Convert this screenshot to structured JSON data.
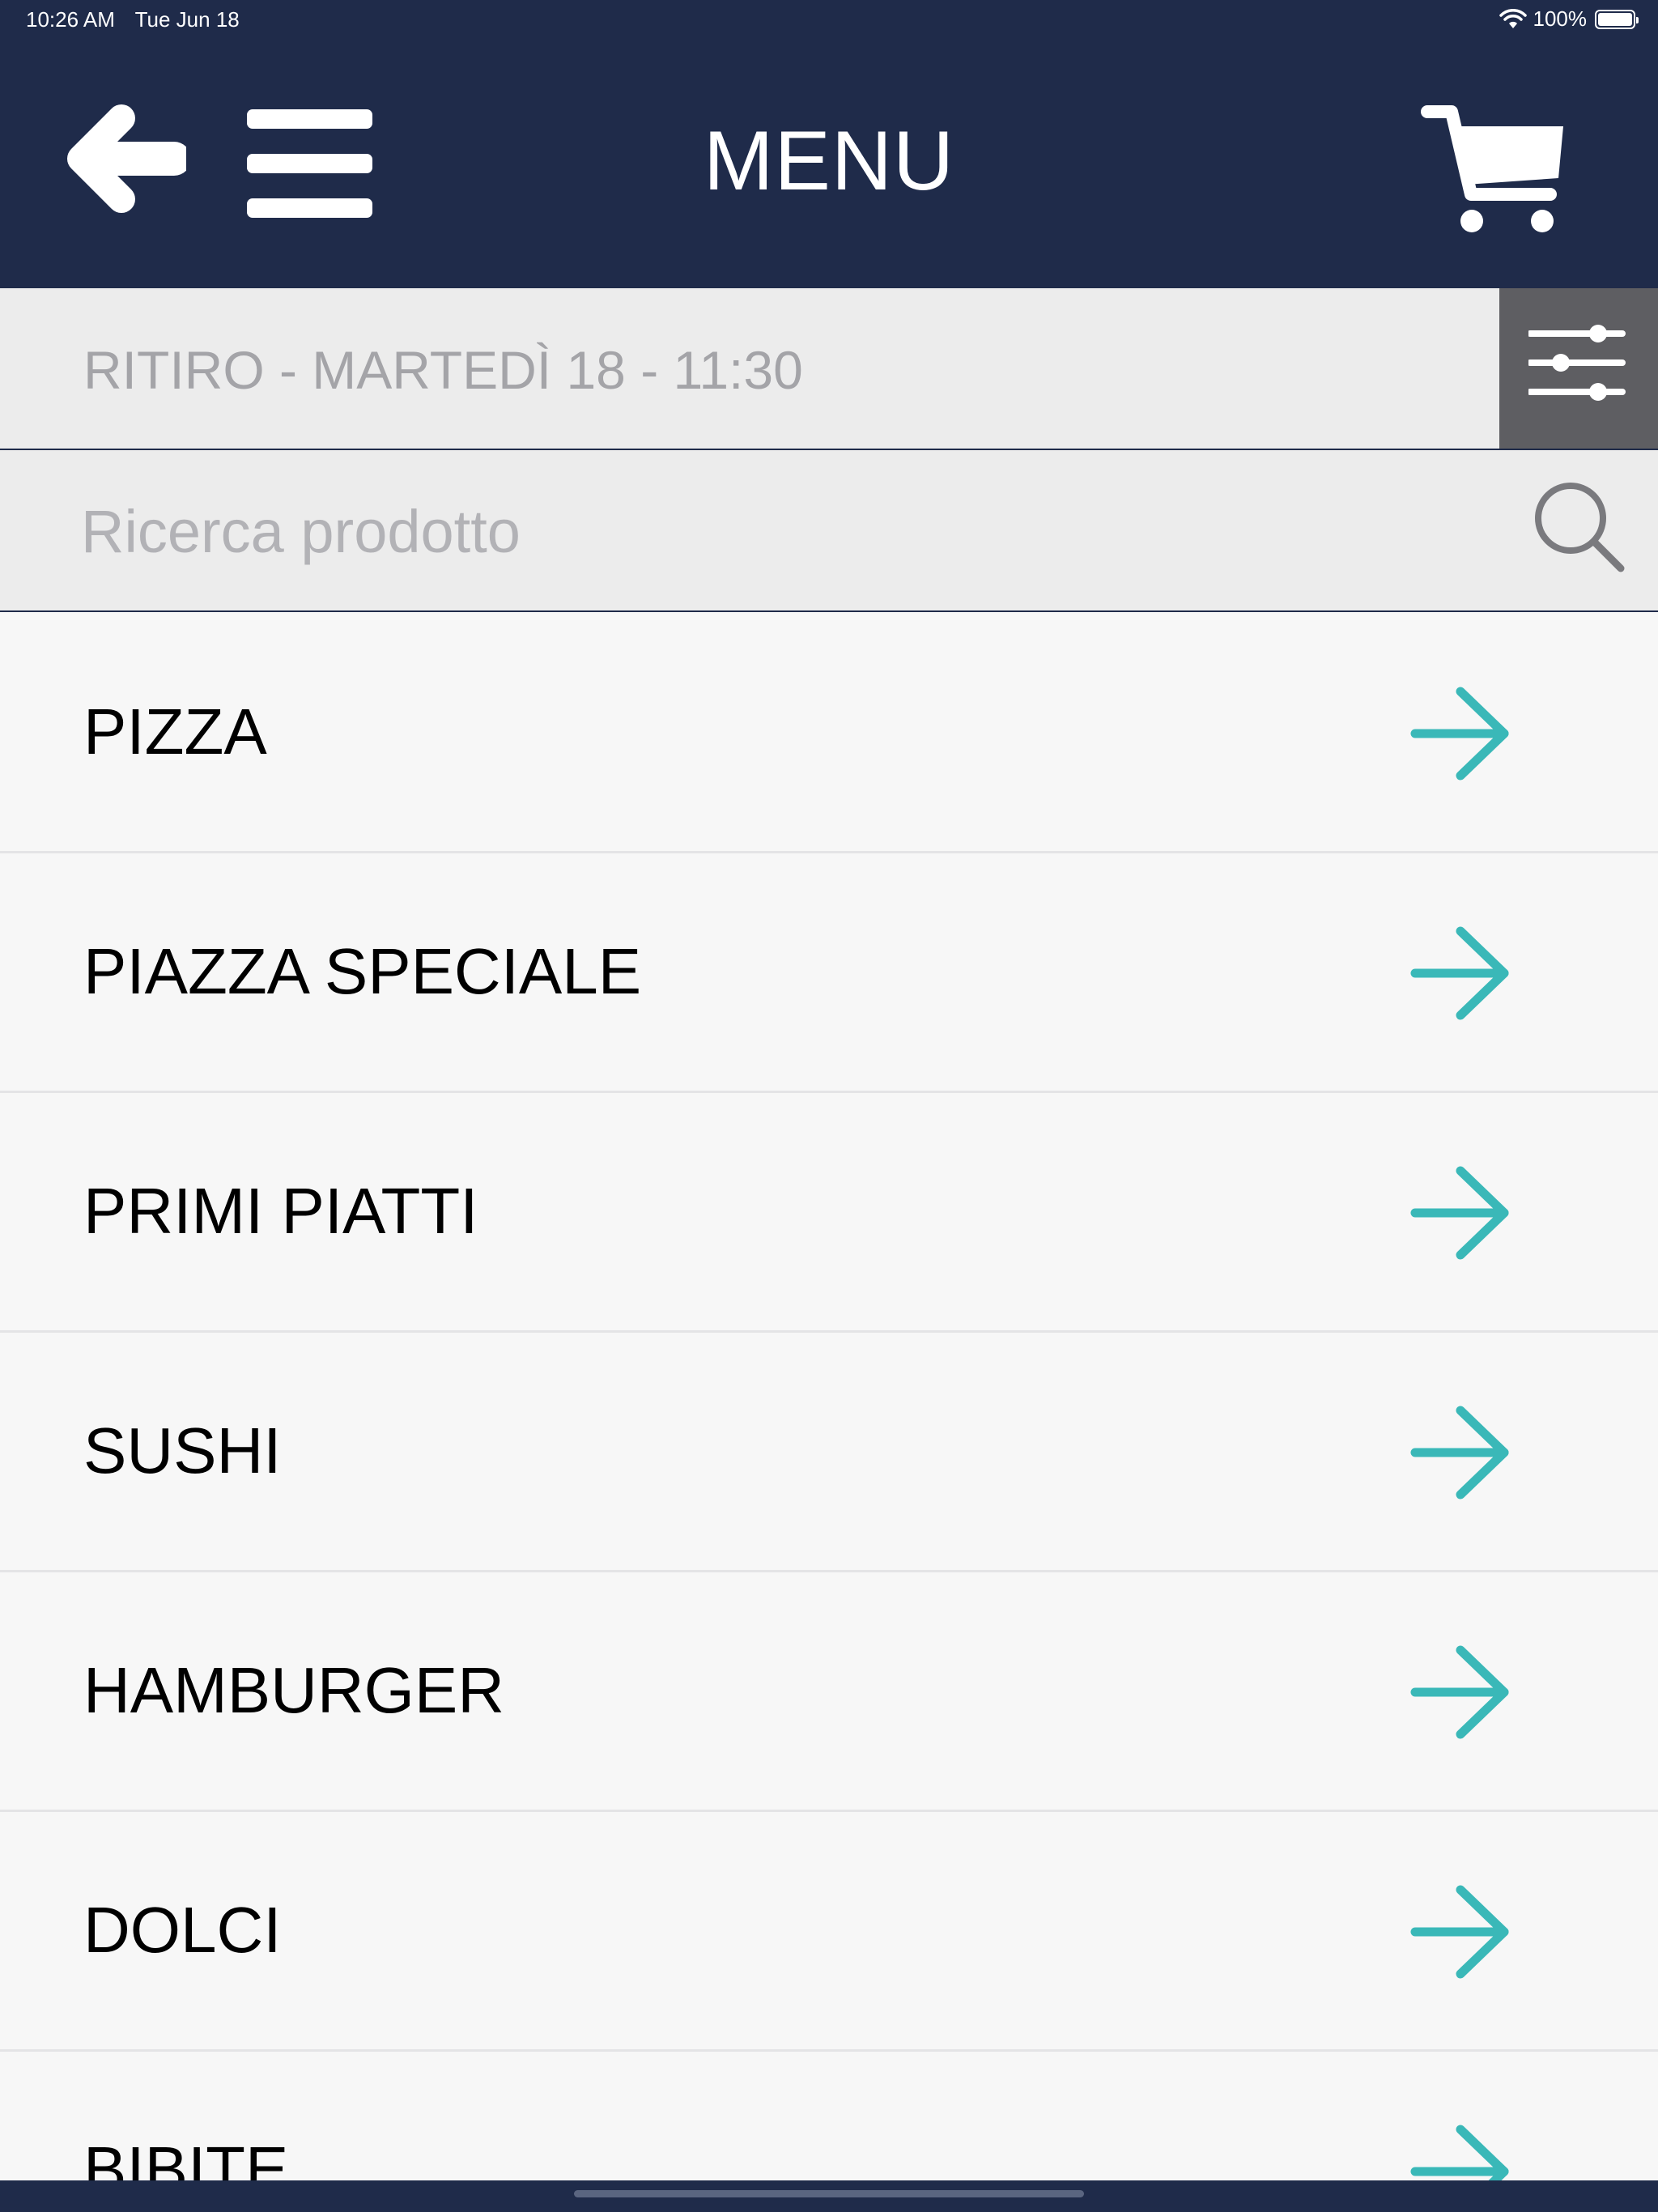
{
  "status": {
    "time": "10:26 AM",
    "date": "Tue Jun 18",
    "battery": "100%"
  },
  "header": {
    "title": "MENU"
  },
  "pickup": {
    "label": "RITIRO - MARTEDÌ 18 - 11:30"
  },
  "search": {
    "placeholder": "Ricerca prodotto",
    "value": ""
  },
  "categories": [
    {
      "label": "PIZZA"
    },
    {
      "label": "PIAZZA SPECIALE"
    },
    {
      "label": "PRIMI PIATTI"
    },
    {
      "label": "SUSHI"
    },
    {
      "label": "HAMBURGER"
    },
    {
      "label": "DOLCI"
    },
    {
      "label": "BIBITE"
    }
  ],
  "colors": {
    "navy": "#1f2b4a",
    "accent": "#3ab8b8",
    "filter_bg": "#5e5e62"
  },
  "icons": [
    "back-arrow-icon",
    "hamburger-menu-icon",
    "cart-icon",
    "filter-sliders-icon",
    "search-icon",
    "arrow-right-icon"
  ]
}
